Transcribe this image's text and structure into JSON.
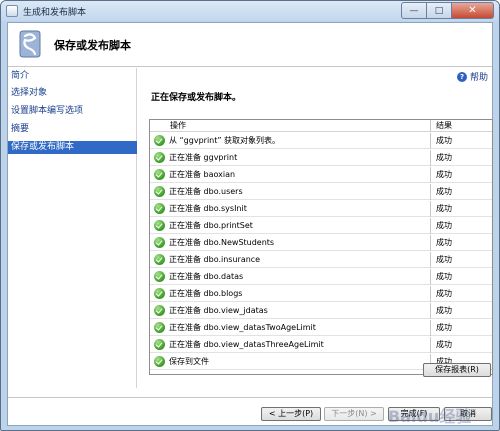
{
  "window": {
    "title": "生成和发布脚本",
    "minimize_label": "—",
    "maximize_label": "□",
    "close_label": "✕"
  },
  "header": {
    "title": "保存或发布脚本"
  },
  "help": {
    "label": "帮助"
  },
  "sidebar": {
    "items": [
      {
        "label": "简介"
      },
      {
        "label": "选择对象"
      },
      {
        "label": "设置脚本编写选项"
      },
      {
        "label": "摘要"
      },
      {
        "label": "保存或发布脚本"
      }
    ]
  },
  "main": {
    "status": "正在保存或发布脚本。",
    "columns": {
      "operation": "操作",
      "result": "结果"
    },
    "rows": [
      {
        "operation": "从 “ggvprint” 获取对象列表。",
        "result": "成功"
      },
      {
        "operation": "正在准备 ggvprint",
        "result": "成功"
      },
      {
        "operation": "正在准备 baoxian",
        "result": "成功"
      },
      {
        "operation": "正在准备 dbo.users",
        "result": "成功"
      },
      {
        "operation": "正在准备 dbo.sysInit",
        "result": "成功"
      },
      {
        "operation": "正在准备 dbo.printSet",
        "result": "成功"
      },
      {
        "operation": "正在准备 dbo.NewStudents",
        "result": "成功"
      },
      {
        "operation": "正在准备 dbo.insurance",
        "result": "成功"
      },
      {
        "operation": "正在准备 dbo.datas",
        "result": "成功"
      },
      {
        "operation": "正在准备 dbo.blogs",
        "result": "成功"
      },
      {
        "operation": "正在准备 dbo.view_jdatas",
        "result": "成功"
      },
      {
        "operation": "正在准备 dbo.view_datasTwoAgeLimit",
        "result": "成功"
      },
      {
        "operation": "正在准备 dbo.view_datasThreeAgeLimit",
        "result": "成功"
      },
      {
        "operation": "保存到文件",
        "result": "成功"
      }
    ],
    "save_report_label": "保存报表(R)"
  },
  "footer": {
    "prev_label": "< 上一步(P)",
    "next_label": "下一步(N) >",
    "finish_label": "完成(F)",
    "cancel_label": "取消"
  },
  "watermark": "Baidu经验",
  "colors": {
    "accent": "#3169c6",
    "success": "#3f9f2a",
    "link": "#1a3e8c"
  }
}
